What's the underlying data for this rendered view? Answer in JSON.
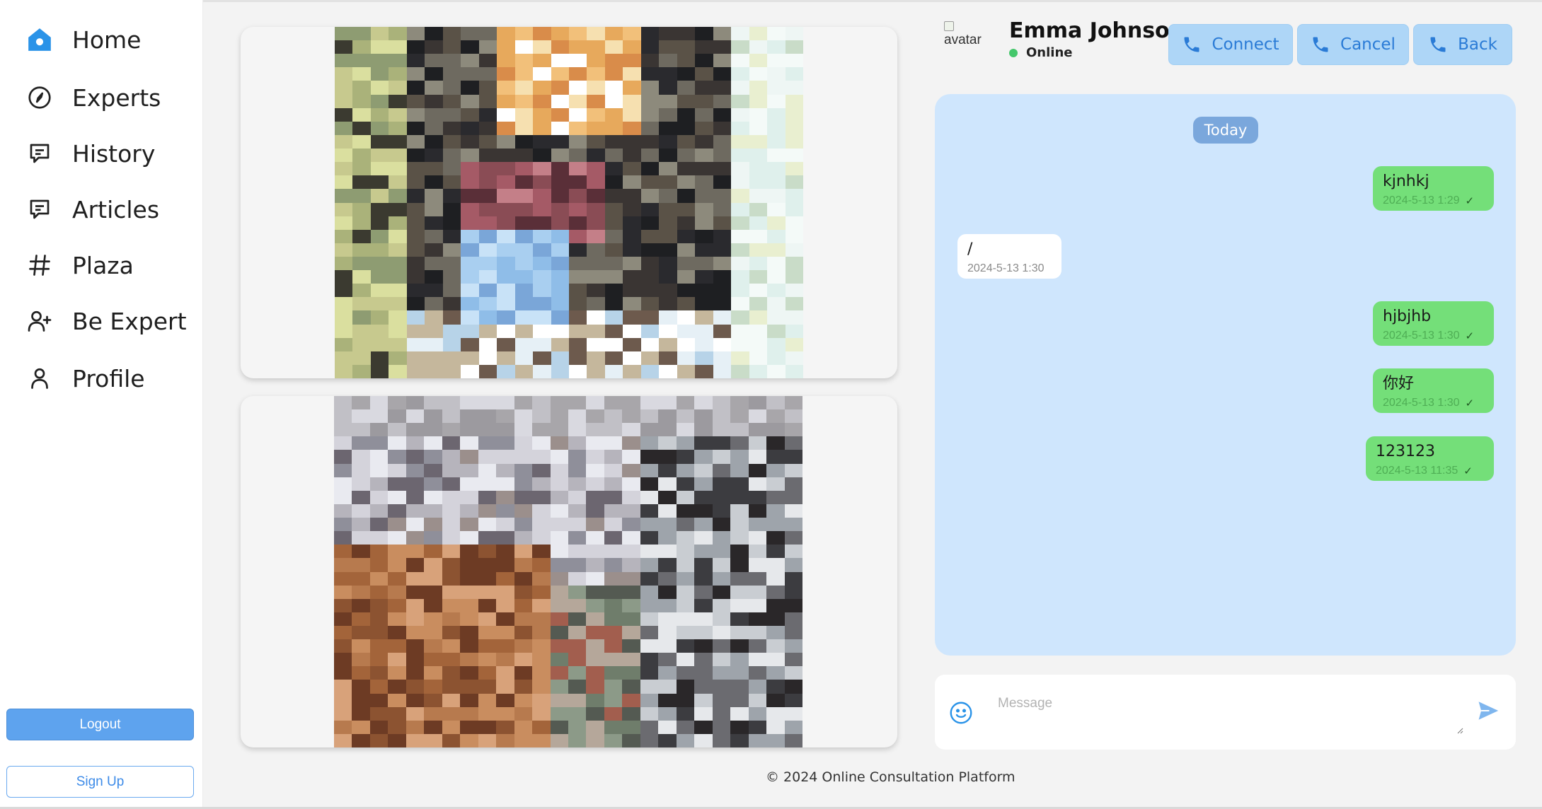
{
  "sidebar": {
    "items": [
      {
        "label": "Home",
        "icon": "home-icon"
      },
      {
        "label": "Experts",
        "icon": "compass-icon"
      },
      {
        "label": "History",
        "icon": "chat-bubble-icon"
      },
      {
        "label": "Articles",
        "icon": "chat-bubble-icon"
      },
      {
        "label": "Plaza",
        "icon": "hash-icon"
      },
      {
        "label": "Be Expert",
        "icon": "user-plus-icon"
      },
      {
        "label": "Profile",
        "icon": "user-icon"
      }
    ],
    "logout_label": "Logout",
    "signup_label": "Sign Up"
  },
  "chat": {
    "avatar_alt": "avatar",
    "name": "Emma Johnson",
    "status": "Online",
    "buttons": {
      "connect": "Connect",
      "cancel": "Cancel",
      "back": "Back"
    },
    "date_divider": "Today",
    "messages": [
      {
        "text": "kjnhkj",
        "time": "2024-5-13 1:29",
        "direction": "out",
        "read": true
      },
      {
        "text": "/",
        "time": "2024-5-13 1:30",
        "direction": "in",
        "read": false
      },
      {
        "text": "hjbjhb",
        "time": "2024-5-13 1:30",
        "direction": "out",
        "read": true
      },
      {
        "text": "你好",
        "time": "2024-5-13 1:30",
        "direction": "out",
        "read": true
      },
      {
        "text": "123123",
        "time": "2024-5-13 11:35",
        "direction": "out",
        "read": true
      }
    ],
    "input_placeholder": "Message",
    "input_value": ""
  },
  "footer": "© 2024 Online Consultation Platform",
  "colors": {
    "accent": "#2a7bd6",
    "chat_bg": "#cfe6fd",
    "out_bubble": "#74df79",
    "online": "#44c76b"
  }
}
